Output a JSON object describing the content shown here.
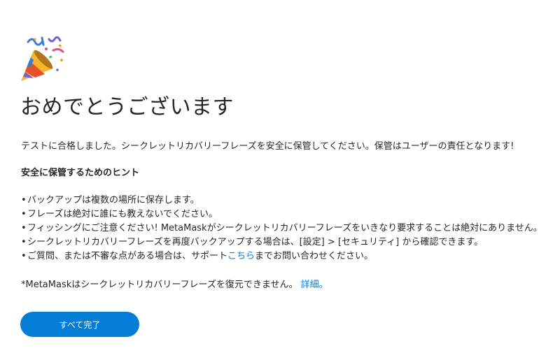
{
  "header": {
    "icon": "party-popper-icon",
    "title": "おめでとうございます"
  },
  "main": {
    "intro": "テストに合格しました。シークレットリカバリーフレーズを安全に保管してください。保管はユーザーの責任となります!",
    "tips_heading": "安全に保管するためのヒント",
    "bullet": "•",
    "tips": [
      "バックアップは複数の場所に保存します。",
      "フレーズは絶対に誰にも教えないでください。",
      "フィッシングにご注意ください! MetaMaskがシークレットリカバリーフレーズをいきなり要求することは絶対にありません。",
      "シークレットリカバリーフレーズを再度バックアップする場合は、[設定] > [セキュリティ] から確認できます。"
    ],
    "support_tip": {
      "before": "ご質問、または不審な点がある場合は、サポート",
      "link": "こちら",
      "after": "までお問い合わせください。"
    },
    "footnote": {
      "text": "*MetaMaskはシークレットリカバリーフレーズを復元できません。",
      "link": "詳細。"
    }
  },
  "actions": {
    "done_label": "すべて完了"
  },
  "colors": {
    "accent": "#037dd6",
    "text": "#24272a",
    "background": "#ffffff"
  }
}
